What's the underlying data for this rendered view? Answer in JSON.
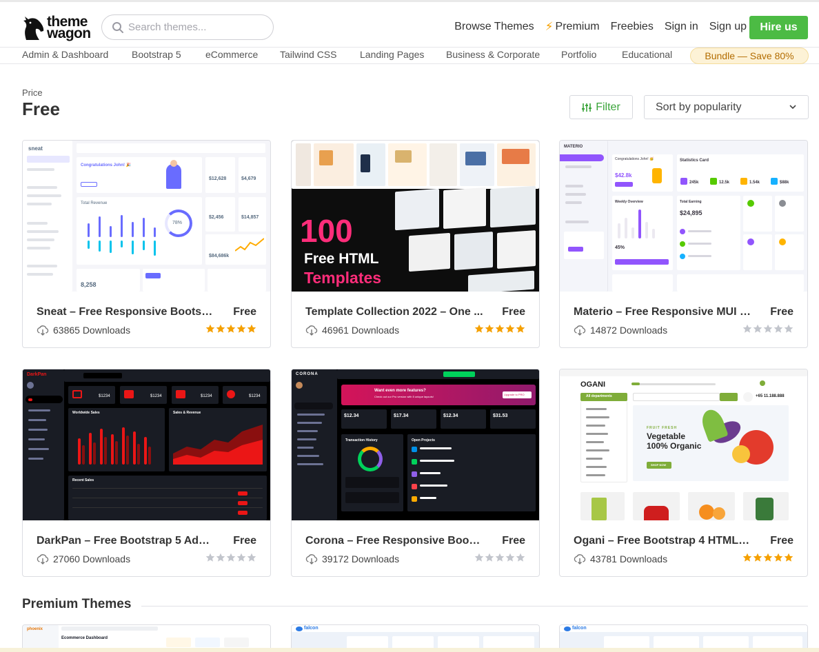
{
  "header": {
    "logo_line1": "theme",
    "logo_line2": "wagon",
    "search_placeholder": "Search themes...",
    "nav": {
      "browse": "Browse Themes",
      "premium": "Premium",
      "freebies": "Freebies",
      "signin": "Sign in",
      "signup": "Sign up"
    },
    "hire_label": "Hire us"
  },
  "categories": [
    "Admin & Dashboard",
    "Bootstrap 5",
    "eCommerce",
    "Tailwind CSS",
    "Landing Pages",
    "Business & Corporate",
    "Portfolio",
    "Educational"
  ],
  "bundle_label": "Bundle — Save 80%",
  "page": {
    "price_label": "Price",
    "title": "Free",
    "filter_label": "Filter",
    "sort_label": "Sort by popularity"
  },
  "cards": [
    {
      "title": "Sneat – Free Responsive Bootstr...",
      "price": "Free",
      "downloads": "63865 Downloads",
      "rating": 5
    },
    {
      "title": "Template Collection 2022 – One ...",
      "price": "Free",
      "downloads": "46961 Downloads",
      "rating": 5
    },
    {
      "title": "Materio – Free Responsive MUI R...",
      "price": "Free",
      "downloads": "14872 Downloads",
      "rating": 0
    },
    {
      "title": "DarkPan – Free Bootstrap 5 Adm...",
      "price": "Free",
      "downloads": "27060 Downloads",
      "rating": 0
    },
    {
      "title": "Corona – Free Responsive Boots...",
      "price": "Free",
      "downloads": "39172 Downloads",
      "rating": 0
    },
    {
      "title": "Ogani – Free Bootstrap 4 HTML5...",
      "price": "Free",
      "downloads": "43781 Downloads",
      "rating": 5
    }
  ],
  "thumbs": {
    "sneat": {
      "brand": "sneat",
      "greeting": "Congratulations John! 🎉",
      "profit": "$12,628",
      "sales": "$4,679",
      "payments": "$2,456",
      "transactions": "$14,857",
      "order_total": "8,258",
      "growth": "78%",
      "revenue_label": "Total Revenue",
      "report_value": "$84,686k"
    },
    "collection": {
      "line1": "100",
      "line2": "Free HTML",
      "line3": "Templates"
    },
    "materio": {
      "brand": "MATERIO",
      "greeting": "Congratulations John! 🥳",
      "amount": "$42.8k",
      "stats_title": "Statistics Card",
      "earning_title": "Total Earning",
      "earning_value": "$24,895",
      "weekly_title": "Weekly Overview",
      "weekly_pct": "45%",
      "s1": "245k",
      "s2": "12.5k",
      "s3": "1.54k",
      "s4": "$88k"
    },
    "darkpan": {
      "brand": "DarkPan",
      "v1": "$1234",
      "v2": "$1234",
      "v3": "$1234",
      "v4": "$1234",
      "worldwide": "Worldwide Sales",
      "salesrev": "Sales & Revenue",
      "recent": "Recent Sales"
    },
    "corona": {
      "brand": "CORONA",
      "banner_title": "Want even more features?",
      "banner_sub": "Check out our Pro version with 5 unique layouts!",
      "banner_btn": "Upgrade to PRO",
      "v1": "$12.34",
      "v2": "$17.34",
      "v3": "$12.34",
      "v4": "$31.53",
      "txn": "Transaction History",
      "projects": "Open Projects"
    },
    "ogani": {
      "brand": "OGANI",
      "dept": "All departments",
      "tag": "FRUIT FRESH",
      "headline1": "Vegetable",
      "headline2": "100% Organic",
      "shop": "SHOP NOW",
      "phone": "+65 11.188.888"
    }
  },
  "premium_title": "Premium Themes",
  "premium_cards": [
    {
      "brand": "phoenix",
      "heading": "Ecommerce Dashboard"
    },
    {
      "brand": "falcon"
    },
    {
      "brand": "falcon"
    }
  ],
  "colors": {
    "accent_green": "#4cbb44",
    "star_gold": "#f5a000",
    "star_gray": "#c2c5cc"
  }
}
